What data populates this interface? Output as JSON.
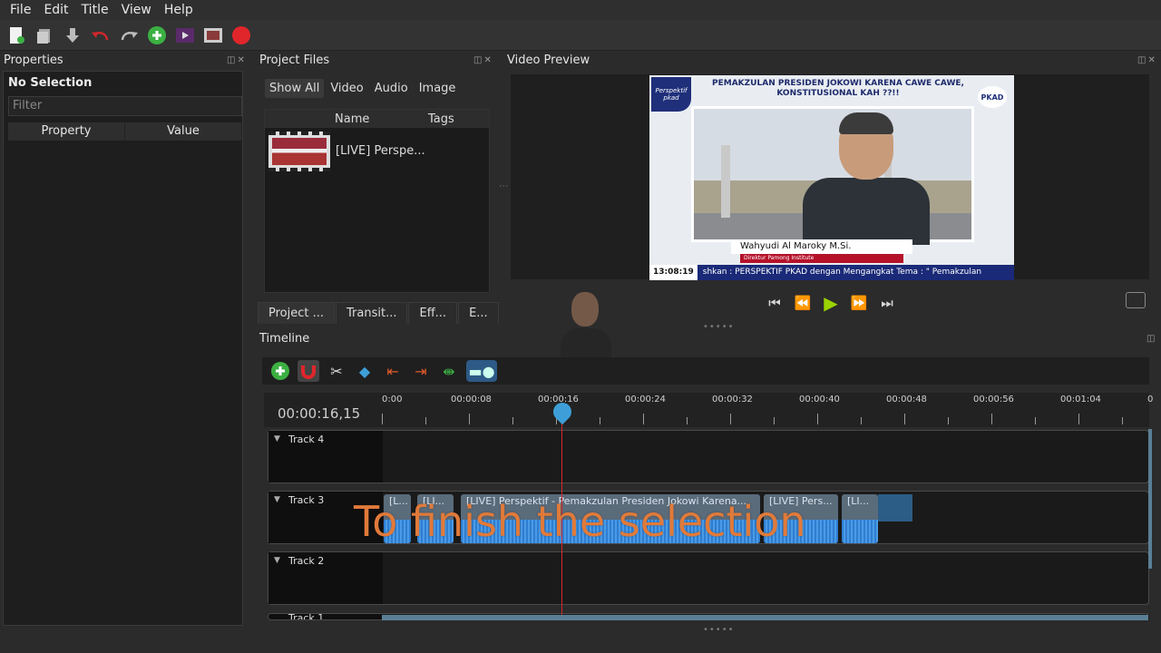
{
  "menu": [
    "File",
    "Edit",
    "Title",
    "View",
    "Help"
  ],
  "panels": {
    "properties": "Properties",
    "project_files": "Project Files",
    "video_preview": "Video Preview",
    "timeline": "Timeline"
  },
  "properties": {
    "selection": "No Selection",
    "filter_placeholder": "Filter",
    "col_property": "Property",
    "col_value": "Value"
  },
  "project_files": {
    "tabs": [
      "Show All",
      "Video",
      "Audio",
      "Image"
    ],
    "col_name": "Name",
    "col_tags": "Tags",
    "file_name": "[LIVE] Perspe..."
  },
  "bottom_tabs": [
    "Project ...",
    "Transit...",
    "Eff...",
    "E..."
  ],
  "video": {
    "banner": "PEMAKZULAN PRESIDEN JOKOWI KARENA CAWE CAWE, KONSTITUSIONAL KAH ??!!",
    "badge": "Perspektif pkad",
    "logo": "PKAD",
    "speaker": "Wahyudi Al Maroky M.Si.",
    "speaker_role": "Direktur Pamong Institute",
    "ticker_time": "13:08:19",
    "ticker_text": "shkan : PERSPEKTIF PKAD  dengan Mengangkat Tema : \" Pemakzulan"
  },
  "timeline": {
    "timecode": "00:00:16,15",
    "ruler": [
      "0:00",
      "00:00:08",
      "00:00:16",
      "00:00:24",
      "00:00:32",
      "00:00:40",
      "00:00:48",
      "00:00:56",
      "00:01:04",
      "0"
    ],
    "tracks": [
      "Track 4",
      "Track 3",
      "Track 2",
      "Track 1"
    ],
    "clips": [
      "[L...",
      "[LI...",
      "[LIVE] Perspektif - Pemakzulan Presiden Jokowi Karena...",
      "[LIVE] Pers...",
      "[LI..."
    ]
  },
  "caption": "To finish the selection",
  "colors": {
    "accent_green": "#3cb043",
    "record_red": "#e0262b",
    "playhead": "#d9252a",
    "caption": "#e07a3a"
  }
}
